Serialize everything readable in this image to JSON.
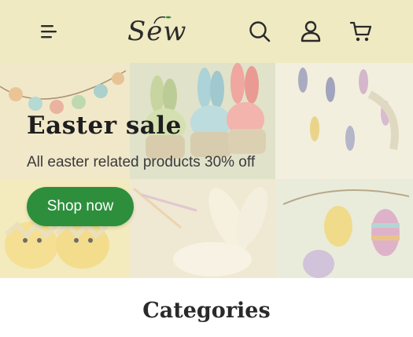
{
  "header": {
    "menu_icon": "menu-icon",
    "logo_text": "Sew",
    "search_icon": "search-icon",
    "account_icon": "user-icon",
    "cart_icon": "cart-icon",
    "background": "#efeac2"
  },
  "hero": {
    "title": "Easter sale",
    "subtitle": "All easter related products 30% off",
    "cta_label": "Shop now",
    "cta_color": "#2d8f3c"
  },
  "categories": {
    "title": "Categories"
  }
}
